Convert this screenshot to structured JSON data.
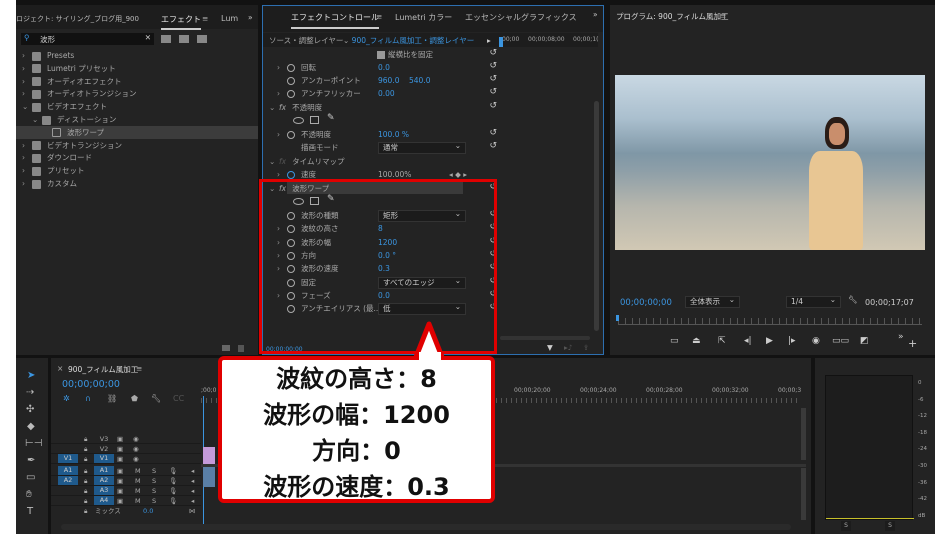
{
  "effects_panel": {
    "tabs": [
      "ロジェクト: サイリング_ブログ用_900",
      "エフェクト",
      "Lum"
    ],
    "search_value": "波形",
    "tree": [
      {
        "label": "Presets",
        "level": 0,
        "open": false
      },
      {
        "label": "Lumetri プリセット",
        "level": 0,
        "open": false
      },
      {
        "label": "オーディオエフェクト",
        "level": 0,
        "open": false
      },
      {
        "label": "オーディオトランジション",
        "level": 0,
        "open": false
      },
      {
        "label": "ビデオエフェクト",
        "level": 0,
        "open": true
      },
      {
        "label": "ディストーション",
        "level": 1,
        "open": true
      },
      {
        "label": "波形ワープ",
        "level": 2,
        "selected": true
      },
      {
        "label": "ビデオトランジション",
        "level": 0,
        "open": false
      },
      {
        "label": "ダウンロード",
        "level": 0,
        "open": false
      },
      {
        "label": "プリセット",
        "level": 0,
        "open": false
      },
      {
        "label": "カスタム",
        "level": 0,
        "open": false
      }
    ]
  },
  "effect_controls": {
    "tabs": [
      "エフェクトコントロール",
      "Lumetri カラー",
      "エッセンシャルグラフィックス"
    ],
    "source_label": "ソース・調整レイヤー",
    "source_clip": "900_フィルム風加工・調整レイヤー",
    "ruler": [
      ";00;00",
      "00;00;08;00",
      "00;00;1("
    ],
    "lock_ratio": "縦横比を固定",
    "rotation": {
      "label": "回転",
      "value": "0.0"
    },
    "anchor": {
      "label": "アンカーポイント",
      "x": "960.0",
      "y": "540.0"
    },
    "antiflicker": {
      "label": "アンチフリッカー",
      "value": "0.00"
    },
    "opacity_section": "不透明度",
    "opacity": {
      "label": "不透明度",
      "value": "100.0 %"
    },
    "blend": {
      "label": "描画モード",
      "value": "通常"
    },
    "timeremap": "タイムリマップ",
    "speed": {
      "label": "速度",
      "value": "100.00%"
    },
    "wave_section": "波形ワープ",
    "wave": [
      {
        "label": "波形の種類",
        "value": "矩形",
        "type": "select",
        "chev": false
      },
      {
        "label": "波紋の高さ",
        "value": "8",
        "type": "num",
        "chev": true
      },
      {
        "label": "波形の幅",
        "value": "1200",
        "type": "num",
        "chev": true
      },
      {
        "label": "方向",
        "value": "0.0 °",
        "type": "num",
        "chev": true
      },
      {
        "label": "波形の速度",
        "value": "0.3",
        "type": "num",
        "chev": true
      },
      {
        "label": "固定",
        "value": "すべてのエッジ",
        "type": "select",
        "chev": false
      },
      {
        "label": "フェーズ",
        "value": "0.0",
        "type": "num",
        "chev": true
      },
      {
        "label": "アンチエイリアス (最...",
        "value": "低",
        "type": "select",
        "chev": false
      }
    ],
    "timecode": "00;00;00;00"
  },
  "program": {
    "title": "プログラム: 900_フィルム風加工",
    "timecode": "00;00;00;00",
    "zoom": "全体表示",
    "resolution": "1/4",
    "duration": "00;00;17;07"
  },
  "timeline": {
    "title": "900_フィルム風加工",
    "timecode": "00;00;00;00",
    "ruler": [
      ";00;0",
      "00;00;20;00",
      "00;00;24;00",
      "00;00;28;00",
      "00;00;32;00",
      "00;00;3"
    ],
    "video_tracks": [
      "V3",
      "V2",
      "V1"
    ],
    "audio_tracks": [
      "A1",
      "A2",
      "A3",
      "A4"
    ],
    "source_v": "V1",
    "source_a": [
      "A1",
      "A2"
    ],
    "mix_label": "ミックス",
    "mix_value": "0.0",
    "m": "M",
    "s": "S"
  },
  "meter": {
    "scale": [
      "0",
      "-6",
      "-12",
      "-18",
      "-24",
      "-30",
      "-36",
      "-42",
      "dB"
    ],
    "solo": "S"
  },
  "callout": {
    "lines": [
      "波紋の高さ：8",
      "波形の幅：1200",
      "方向：0",
      "波形の速度：0.3"
    ],
    "border_color": "#e00000"
  }
}
